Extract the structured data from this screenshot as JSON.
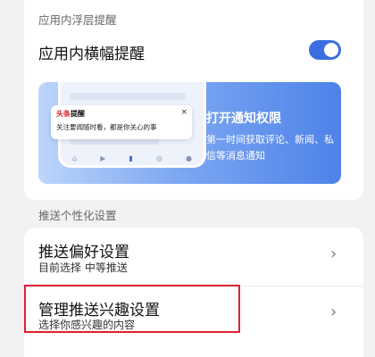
{
  "section1": {
    "title": "应用内浮层提醒",
    "banner_toggle_label": "应用内横幅提醒",
    "banner_toggle_on": true
  },
  "promo": {
    "notification": {
      "app_name_red": "头条",
      "app_name_black": "提醒",
      "body": "关注要闻随时看，都是你关心的事",
      "close": "×"
    },
    "title": "打开通知权限",
    "description": "第一时间获取评论、新闻、私信等消息通知"
  },
  "section2": {
    "title": "推送个性化设置",
    "items": [
      {
        "title": "推送偏好设置",
        "subtitle": "目前选择 中等推送",
        "chevron": "›"
      },
      {
        "title": "管理推送兴趣设置",
        "subtitle": "选择你感兴趣的内容",
        "chevron": "›"
      }
    ]
  },
  "colors": {
    "accent": "#3b6fe0",
    "highlight_border": "#d9232e"
  }
}
